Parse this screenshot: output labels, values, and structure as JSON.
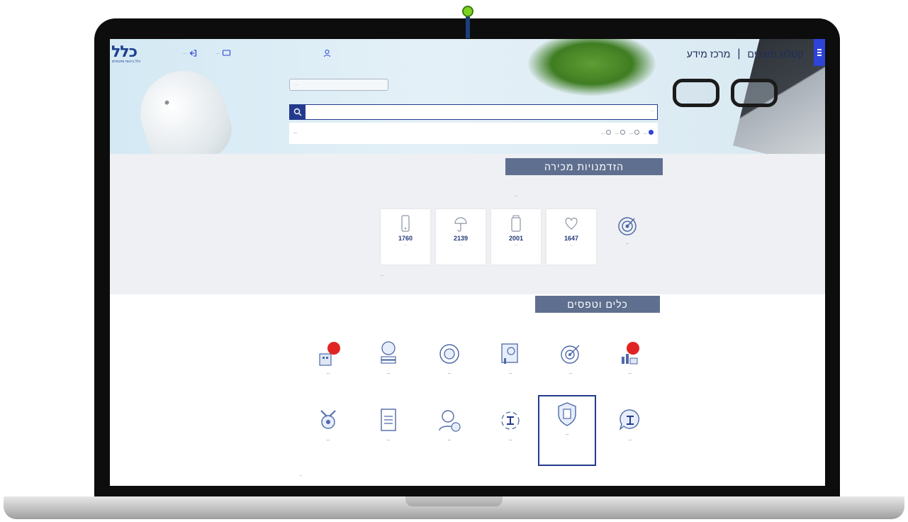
{
  "header": {
    "logo_text": "כלל",
    "logo_subtitle": "כלל ביטוח ופיננסים",
    "util_link_1": "...",
    "util_link_2": "...",
    "nav_catalog": "קטלוג מוצרים",
    "nav_info": "מרכז מידע"
  },
  "search": {
    "select_placeholder": "...",
    "input_placeholder": "...",
    "advanced_label": "...",
    "radio_options": [
      "...",
      "...",
      "...",
      "..."
    ]
  },
  "sales_section": {
    "title": "הזדמנויות מכירה",
    "subtitle": "...",
    "target_label": "...",
    "stats": [
      {
        "value": "1760",
        "label": "..."
      },
      {
        "value": "2139",
        "label": "..."
      },
      {
        "value": "2001",
        "label": "..."
      },
      {
        "value": "1647",
        "label": "..."
      }
    ],
    "more_link": "..."
  },
  "tools_section": {
    "title": "כלים וטפסים",
    "row1": [
      {
        "label": "...",
        "icon": "building-badge-icon"
      },
      {
        "label": "...",
        "icon": "coin-stack-icon"
      },
      {
        "label": "...",
        "icon": "circular-target-icon"
      },
      {
        "label": "...",
        "icon": "calculator-chart-icon"
      },
      {
        "label": "...",
        "icon": "target-arrow-icon"
      },
      {
        "label": "...",
        "icon": "chart-badge-icon"
      }
    ],
    "row2": [
      {
        "label": "...",
        "icon": "tools-gear-icon"
      },
      {
        "label": "...",
        "icon": "document-icon"
      },
      {
        "label": "...",
        "icon": "agent-icon"
      },
      {
        "label": "...",
        "icon": "clal-logo-cycle-icon"
      },
      {
        "label": "...",
        "icon": "shield-doc-icon"
      },
      {
        "label": "...",
        "icon": "clal-bubble-icon"
      }
    ]
  },
  "footer": {
    "link_text": "..."
  },
  "colors": {
    "brand_blue": "#243a8c",
    "section_title_bg": "#5f6f8f",
    "menu_blue": "#2d44d6"
  }
}
